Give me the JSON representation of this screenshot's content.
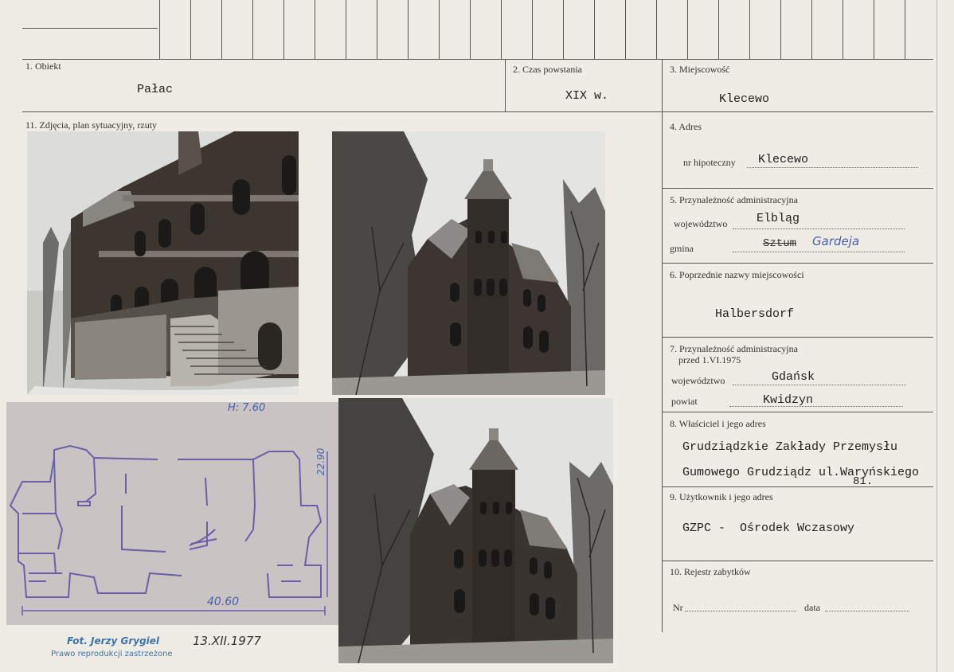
{
  "fields": {
    "f1_label": "1. Obiekt",
    "f1_value": "Pałac",
    "f2_label": "2. Czas powstania",
    "f2_value": "XIX w.",
    "f3_label": "3. Miejscowość",
    "f3_value": "Klecewo",
    "f11_label": "11. Zdjęcia, plan sytuacyjny, rzuty",
    "f4_label": "4. Adres",
    "f4_sub": "nr hipoteczny",
    "f4_value": "Klecewo",
    "f5_label": "5. Przynależność administracyjna",
    "f5_woj_label": "województwo",
    "f5_woj_value": "Elbląg",
    "f5_gmina_label": "gmina",
    "f5_gmina_struck": "Sztum",
    "f5_gmina_hand": "Gardeja",
    "f6_label": "6. Poprzednie nazwy miejscowości",
    "f6_value": "Halbersdorf",
    "f7_label_1": "7. Przynależność administracyjna",
    "f7_label_2": "przed 1.VI.1975",
    "f7_woj_label": "województwo",
    "f7_woj_value": "Gdańsk",
    "f7_pow_label": "powiat",
    "f7_pow_value": "Kwidzyn",
    "f8_label": "8. Właściciel i jego adres",
    "f8_line1": "Grudziądzkie Zakłady Przemysłu",
    "f8_line2": "Gumowego Grudziądz ul.Waryńskiego",
    "f8_number": "81.",
    "f9_label": "9. Użytkownik i jego adres",
    "f9_value": "GZPC -  Ośrodek Wczasowy",
    "f10_label": "10. Rejestr zabytków",
    "f10_nr": "Nr",
    "f10_data": "data"
  },
  "plan": {
    "height_note": "H: 7.60",
    "width_dim": "40.60",
    "depth_dim": "22.90"
  },
  "credit": {
    "photographer": "Fot. Jerzy Grygiel",
    "rights": "Prawo reprodukcji zastrzeżone",
    "date": "13.XII.1977"
  },
  "colors": {
    "paper": "#efece6",
    "ink": "#2a2a2a",
    "pencil": "#4a5fa8",
    "stamp": "#3c74a8",
    "plan_paper": "#c9c4c3"
  }
}
